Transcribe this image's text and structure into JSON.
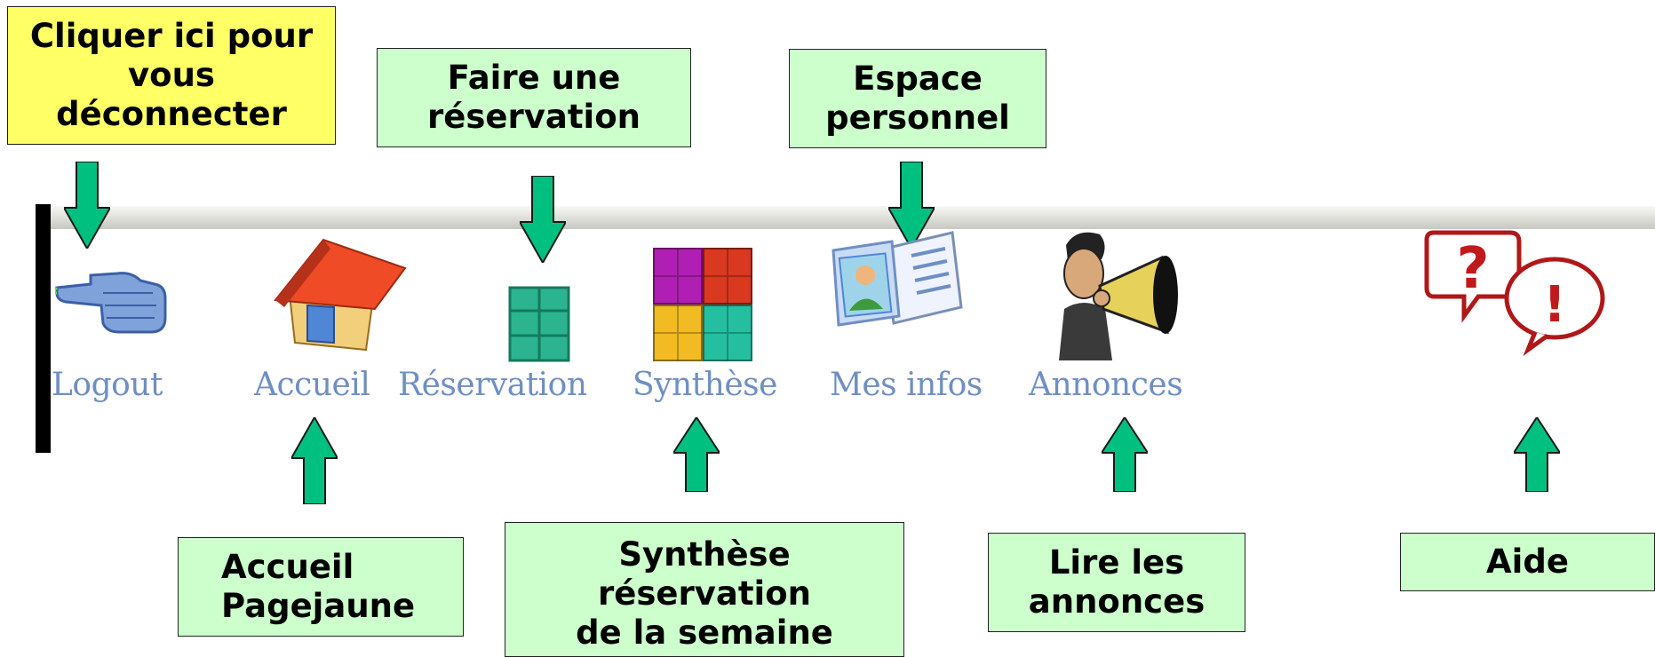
{
  "toolbar": {
    "items": [
      {
        "label": "Logout",
        "icon": "pointing-hand-icon"
      },
      {
        "label": "Accueil",
        "icon": "house-icon"
      },
      {
        "label": "Réservation",
        "icon": "green-grid-icon"
      },
      {
        "label": "Synthèse",
        "icon": "color-grid-icon"
      },
      {
        "label": "Mes infos",
        "icon": "id-card-icon"
      },
      {
        "label": "Annonces",
        "icon": "megaphone-man-icon"
      },
      {
        "label": "",
        "icon": "question-exclamation-bubbles-icon"
      }
    ]
  },
  "callouts": {
    "logout": "Cliquer ici pour\nvous\ndéconnecter",
    "reservation": "Faire une\nréservation",
    "personal": "Espace\npersonnel",
    "home": "Accueil\nPagejaune",
    "synthesis": "Synthèse\nréservation\nde la semaine",
    "announcements": "Lire les\nannonces",
    "help": "Aide"
  },
  "colors": {
    "callout_green": "#ccffcc",
    "callout_yellow": "#ffff66",
    "arrow": "#00c080",
    "label_blue": "#6f8fc3"
  }
}
